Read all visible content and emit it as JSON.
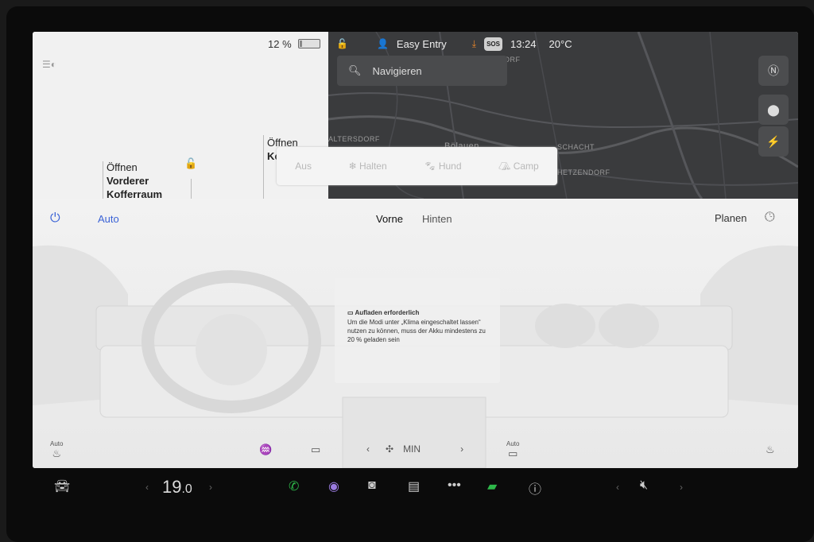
{
  "status": {
    "battery_percent": "12 %",
    "battery_level": 0.12,
    "lock_icon": "lock-open-icon",
    "profile_label": "Easy Entry",
    "sos_label": "SOS",
    "time": "13:24",
    "outside_temp": "20°C"
  },
  "map": {
    "search_placeholder": "Navigieren",
    "place_labels": [
      "DORF",
      "ALTERSDORF",
      "Bölauen",
      "SCHACHT",
      "HETZENDORF"
    ]
  },
  "car": {
    "front_trunk": {
      "line1": "Öffnen",
      "line2": "Vorderer",
      "line3": "Kofferraum"
    },
    "rear_trunk": {
      "line1": "Öffnen",
      "line2": "Ko"
    }
  },
  "modes": [
    "Aus",
    "Halten",
    "Hund",
    "Camp"
  ],
  "climate": {
    "auto_label": "Auto",
    "tab_front": "Vorne",
    "tab_rear": "Hinten",
    "plan_label": "Planen",
    "notice_title": "Aufladen erforderlich",
    "notice_body": "Um die Modi unter „Klima eingeschaltet lassen“ nutzen zu können, muss der Akku mindestens zu 20 % geladen sein",
    "seat_left_label": "Auto",
    "seat_right_label": "Auto",
    "fan_speed": "MIN"
  },
  "dock": {
    "temperature_int": "19",
    "temperature_dec": ".0"
  },
  "colors": {
    "accent": "#3b63d6",
    "download": "#e8862a",
    "phone": "#2eb84a"
  }
}
